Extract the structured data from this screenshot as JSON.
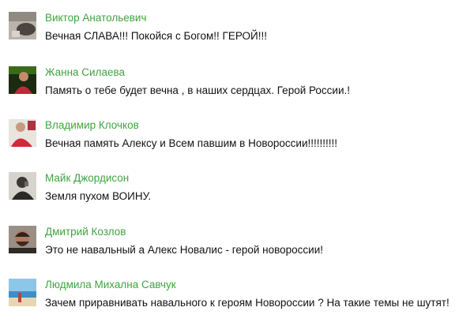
{
  "comments": [
    {
      "author": "Виктор Анатольевич",
      "text": "Вечная СЛАВА!!! Покойся с Богом!! ГЕРОЙ!!!",
      "avatar_icon": "user-avatar-icon"
    },
    {
      "author": "Жанна Силаева",
      "text": "Память о тебе будет вечна , в наших сердцах. Герой России.!",
      "avatar_icon": "user-avatar-icon"
    },
    {
      "author": "Владимир Клочков",
      "text": "Вечная память Алексу и Всем павшим в Новороссии!!!!!!!!!!",
      "avatar_icon": "user-avatar-icon"
    },
    {
      "author": "Майк Джордисон",
      "text": "Земля пухом ВОИНУ.",
      "avatar_icon": "user-avatar-icon"
    },
    {
      "author": "Дмитрий Козлов",
      "text": "Это не навальный а Алекс Новалис - герой новороссии!",
      "avatar_icon": "user-avatar-icon"
    },
    {
      "author": "Людмила Михална Савчук",
      "text": "Зачем приравнивать навального к героям Новороссии ? На такие темы не шутят!",
      "avatar_icon": "user-avatar-icon"
    }
  ],
  "colors": {
    "author_link": "#3fa43f",
    "text": "#111111",
    "background": "#ffffff"
  }
}
